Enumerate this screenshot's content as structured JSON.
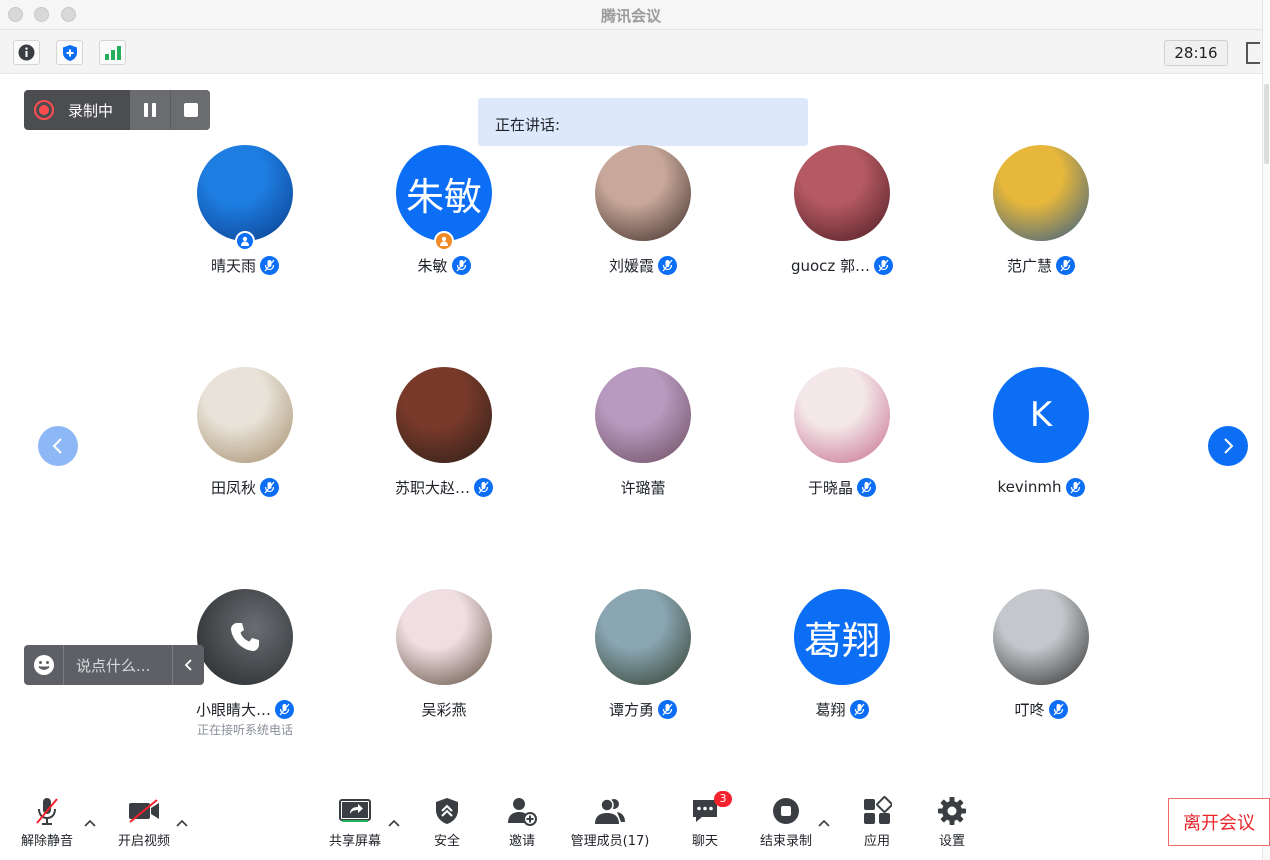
{
  "window": {
    "title": "腾讯会议"
  },
  "toolbar": {
    "timer": "28:16"
  },
  "recording": {
    "label": "录制中"
  },
  "speaking": {
    "label": "正在讲话:"
  },
  "participants": [
    {
      "name": "晴天雨",
      "avatar": "photo",
      "colors": [
        "#1e7de0",
        "#0a3c8a"
      ],
      "badge": "person",
      "badge_color": "#0b6ef5",
      "mic": true
    },
    {
      "name": "朱敏",
      "avatar": "text",
      "avatar_text": "朱敏",
      "badge": "person",
      "badge_color": "#f08a24",
      "mic": true
    },
    {
      "name": "刘媛霞",
      "avatar": "photo",
      "colors": [
        "#c8a89a",
        "#3a2a26"
      ],
      "mic": true
    },
    {
      "name": "guocz 郭…",
      "avatar": "photo",
      "colors": [
        "#b55a62",
        "#4a1a22"
      ],
      "mic": true
    },
    {
      "name": "范广慧",
      "avatar": "photo",
      "colors": [
        "#e6b73b",
        "#2e5a8a"
      ],
      "mic": true
    },
    {
      "name": "田凤秋",
      "avatar": "photo",
      "colors": [
        "#e8e2d8",
        "#a48c6a"
      ],
      "mic": true
    },
    {
      "name": "苏职大赵…",
      "avatar": "photo",
      "colors": [
        "#7a3a2a",
        "#2a1e18"
      ],
      "mic": true
    },
    {
      "name": "许璐蕾",
      "avatar": "photo",
      "colors": [
        "#b89ac0",
        "#6a4a5c"
      ],
      "mic": false
    },
    {
      "name": "于晓晶",
      "avatar": "photo",
      "colors": [
        "#f4e8ea",
        "#c46a8a"
      ],
      "mic": true
    },
    {
      "name": "kevinmh",
      "avatar": "text",
      "avatar_text": "K",
      "mic": true
    },
    {
      "name": "小眼睛大…",
      "avatar": "phone",
      "mic": true,
      "note": "正在接听系统电话"
    },
    {
      "name": "吴彩燕",
      "avatar": "photo",
      "colors": [
        "#f0dfe2",
        "#5a4a3a"
      ],
      "mic": false
    },
    {
      "name": "谭方勇",
      "avatar": "photo",
      "colors": [
        "#8aa6b2",
        "#2e3a2a"
      ],
      "mic": true
    },
    {
      "name": "葛翔",
      "avatar": "text",
      "avatar_text": "葛翔",
      "mic": true
    },
    {
      "name": "叮咚",
      "avatar": "photo",
      "colors": [
        "#c4c8cc",
        "#2a2a2a"
      ],
      "mic": true
    }
  ],
  "chat_input": {
    "placeholder": "说点什么..."
  },
  "bottom": {
    "unmute": "解除静音",
    "video": "开启视频",
    "share": "共享屏幕",
    "security": "安全",
    "invite": "邀请",
    "members": "管理成员(17)",
    "chat": "聊天",
    "chat_badge": "3",
    "end_record": "结束录制",
    "apps": "应用",
    "settings": "设置",
    "leave": "离开会议"
  },
  "colors": {
    "accent": "#0b6ef5",
    "danger": "#e8262c",
    "record": "#ff4d4f"
  }
}
